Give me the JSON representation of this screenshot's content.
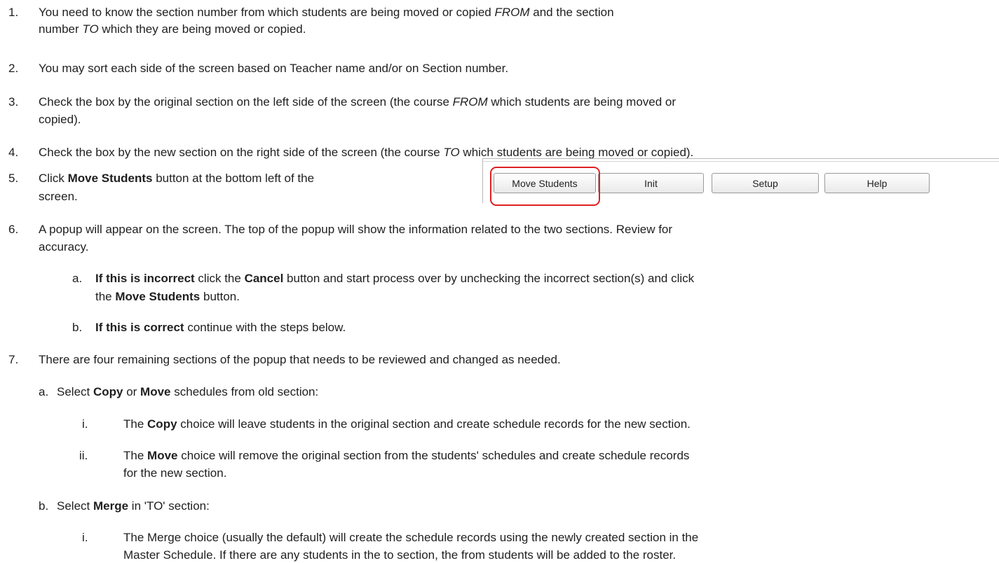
{
  "items": [
    {
      "num": "1.",
      "lines": [
        [
          "You need to know the section number from which students are being moved or copied ",
          {
            "i": "FROM"
          },
          " and the section"
        ],
        [
          "number ",
          {
            "i": "TO"
          },
          " which they are being moved or copied."
        ]
      ]
    },
    {
      "num": "2.",
      "lines": [
        [
          "You may sort each side of the screen based on Teacher name and/or on Section number."
        ]
      ]
    },
    {
      "num": "3.",
      "lines": [
        [
          "Check the box by the original section on the left side of the screen (the course ",
          {
            "i": "FROM"
          },
          " which students are being moved or"
        ],
        [
          "copied)."
        ]
      ]
    },
    {
      "num": "4.",
      "lines": [
        [
          "Check the box by the new section on the right side of the screen (the course ",
          {
            "i": "TO"
          },
          " which students are being moved or copied)."
        ]
      ]
    },
    {
      "num": "5.",
      "lines": [
        [
          "Click ",
          {
            "b": "Move Students"
          },
          " button at the bottom left of the"
        ],
        [
          "screen."
        ]
      ]
    },
    {
      "num": "6.",
      "lines": [
        [
          "A popup will appear on the screen. The top of the popup will show the information related to the two sections. Review for"
        ],
        [
          "accuracy."
        ]
      ]
    },
    {
      "num": "a.",
      "lines": [
        [
          {
            "b": "If this is incorrect"
          },
          " click the ",
          {
            "b": "Cancel"
          },
          " button and start process over by unchecking the incorrect section(s) and click"
        ],
        [
          "the ",
          {
            "b": "Move Students"
          },
          " button."
        ]
      ]
    },
    {
      "num": "b.",
      "lines": [
        [
          {
            "b": "If this is correct"
          },
          " continue with the steps below."
        ]
      ]
    },
    {
      "num": "7.",
      "lines": [
        [
          "There are four remaining sections of the popup that needs to be reviewed and changed as needed."
        ]
      ]
    },
    {
      "num": "a.",
      "lines": [
        [
          "Select ",
          {
            "b": "Copy"
          },
          " or ",
          {
            "b": "Move"
          },
          " schedules from old section:"
        ]
      ]
    },
    {
      "num": "i.",
      "lines": [
        [
          "The ",
          {
            "b": "Copy"
          },
          " choice will leave students in the original section and create schedule records for the new section."
        ]
      ]
    },
    {
      "num": "ii.",
      "lines": [
        [
          "The ",
          {
            "b": "Move"
          },
          " choice will remove the original section from the students' schedules and create schedule records"
        ],
        [
          "for the new section."
        ]
      ]
    },
    {
      "num": "b.",
      "lines": [
        [
          "Select ",
          {
            "b": "Merge"
          },
          " in 'TO' section:"
        ]
      ]
    },
    {
      "num": "i.",
      "lines": [
        [
          "The Merge choice (usually the default) will create the schedule records using the newly created section in the"
        ],
        [
          "Master Schedule. If there are any students in the to section, the from students will be added to the roster."
        ]
      ]
    }
  ],
  "toolbar": {
    "buttons": [
      "Move Students",
      "Init",
      "Setup",
      "Help"
    ]
  }
}
